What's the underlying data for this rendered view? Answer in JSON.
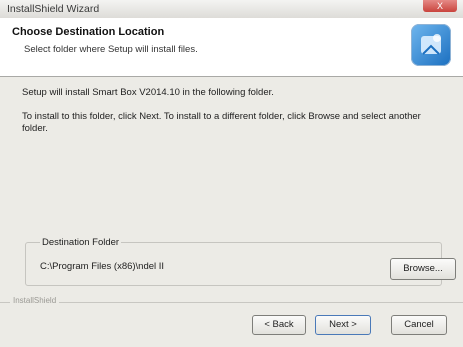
{
  "window": {
    "title": "InstallShield Wizard",
    "close_glyph": "X"
  },
  "header": {
    "title": "Choose Destination Location",
    "subtitle": "Select folder where Setup will install files.",
    "icon": "installer-icon"
  },
  "body": {
    "line1": "Setup will install Smart Box V2014.10 in the following folder.",
    "line2": "To install to this folder, click Next. To install to a different folder, click Browse and select another folder."
  },
  "destination": {
    "legend": "Destination Folder",
    "path": "C:\\Program Files (x86)\\ndel II",
    "browse_label": "Browse..."
  },
  "footer": {
    "brand": "InstallShield",
    "back_label": "< Back",
    "next_label": "Next >",
    "cancel_label": "Cancel"
  }
}
